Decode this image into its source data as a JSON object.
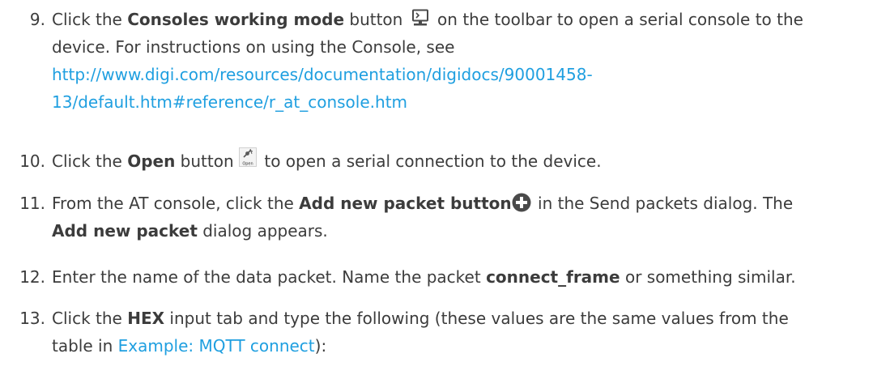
{
  "steps": [
    {
      "number": "9.",
      "line1_pre": "Click the ",
      "line1_bold": "Consoles working mode",
      "line1_mid": " button ",
      "line1_post": " on the toolbar to open a serial console to the",
      "line2": "device. For instructions on using the Console, see",
      "link_line1": "http://www.digi.com/resources/documentation/digidocs/90001458-",
      "link_line2": "13/default.htm#reference/r_at_console.htm",
      "icon": "console-monitor-icon"
    },
    {
      "number": "10.",
      "pre": "Click the ",
      "bold": "Open",
      "mid": " button ",
      "post": " to open a serial connection to the device.",
      "icon": "open-plug-icon",
      "icon_caption": "Open"
    },
    {
      "number": "11.",
      "line1_pre": "From the AT console, click the ",
      "line1_bold": "Add new packet button",
      "line1_post": " in the Send packets dialog. The",
      "line2_bold": "Add new packet",
      "line2_post": " dialog appears.",
      "icon": "add-circle-icon"
    },
    {
      "number": "12.",
      "pre": "Enter the name of the data packet. Name the packet ",
      "bold": "connect_frame",
      "post": " or something similar."
    },
    {
      "number": "13.",
      "line1_pre": "Click the ",
      "line1_bold": "HEX",
      "line1_post": " input tab and type the following (these values are the same values from the",
      "line2_pre": "table in ",
      "line2_link": "Example: MQTT connect",
      "line2_post": "):"
    }
  ],
  "colors": {
    "text": "#3c3c3c",
    "link": "#1f9fe0",
    "icon": "#4a4a4a"
  }
}
